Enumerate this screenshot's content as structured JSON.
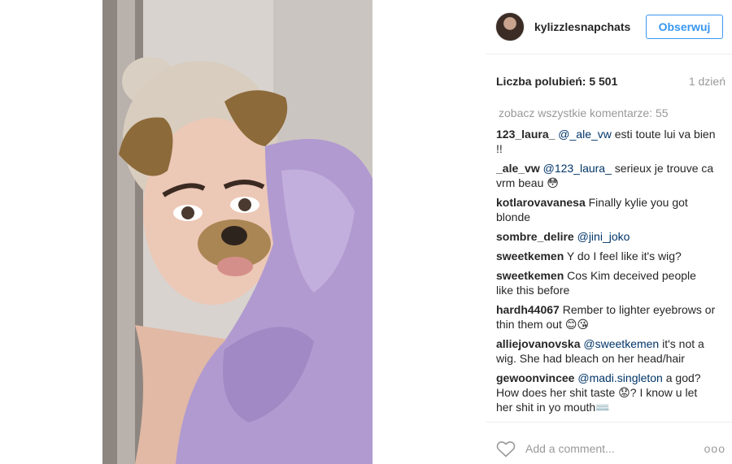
{
  "header": {
    "username": "kylizzlesnapchats",
    "follow_label": "Obserwuj"
  },
  "stats": {
    "likes_label": "Liczba polubień: 5 501",
    "time_ago": "1 dzień"
  },
  "comments": {
    "view_all": "zobacz wszystkie komentarze: 55",
    "items": [
      {
        "user": "123_laura_",
        "mention": "@_ale_vw",
        "text": " esti toute lui va bien !!"
      },
      {
        "user": "_ale_vw",
        "mention": "@123_laura_",
        "text": " serieux je trouve ca vrm beau 😳"
      },
      {
        "user": "kotlarovavanesa",
        "mention": "",
        "text": " Finally kylie you got blonde"
      },
      {
        "user": "sombre_delire",
        "mention": "@jini_joko",
        "text": ""
      },
      {
        "user": "sweetkemen",
        "mention": "",
        "text": " Y do I feel like it's wig?"
      },
      {
        "user": "sweetkemen",
        "mention": "",
        "text": " Cos Kim deceived people like this before"
      },
      {
        "user": "hardh44067",
        "mention": "",
        "text": " Rember to lighter eyebrows or thin them out 😊😘"
      },
      {
        "user": "alliejovanovska",
        "mention": "@sweetkemen",
        "text": " it's not a wig. She had bleach on her head/hair"
      },
      {
        "user": "gewoonvincee",
        "mention": "@madi.singleton",
        "text": " a god? How does her shit taste 😟? I know u let her shit in yo mouth⌨️"
      }
    ]
  },
  "footer": {
    "add_comment_placeholder": "Add a comment...",
    "more_label": "ooo"
  },
  "icons": {
    "heart": "heart-icon",
    "more": "more-options-icon"
  },
  "colors": {
    "accent": "#3897f0",
    "mention": "#003569",
    "muted": "#999999",
    "text": "#262626"
  }
}
